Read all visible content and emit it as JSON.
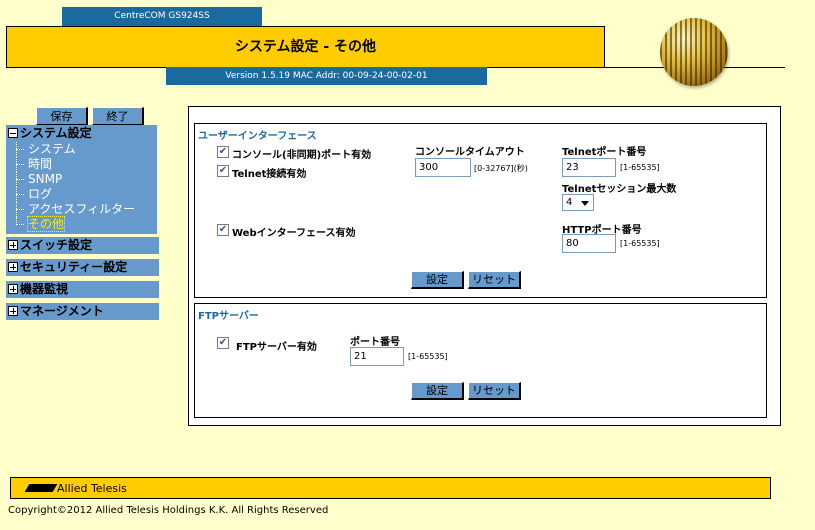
{
  "header": {
    "model": "CentreCOM GS924SS",
    "title": "システム設定 - その他",
    "version": "Version 1.5.19 MAC Addr: 00-09-24-00-02-01"
  },
  "toolbar": {
    "save_label": "保存",
    "exit_label": "終了"
  },
  "sidebar": {
    "system_label": "システム設定",
    "system_items": [
      {
        "label": "システム"
      },
      {
        "label": "時間"
      },
      {
        "label": "SNMP"
      },
      {
        "label": "ログ"
      },
      {
        "label": "アクセスフィルター"
      },
      {
        "label": "その他"
      }
    ],
    "sections": [
      {
        "label": "スイッチ設定"
      },
      {
        "label": "セキュリティー設定"
      },
      {
        "label": "機器監視"
      },
      {
        "label": "マネージメント"
      }
    ]
  },
  "ui_group": {
    "title": "ユーザーインターフェース",
    "console_async_port_label": "コンソール(非同期)ポート有効",
    "console_async_port_enabled": true,
    "telnet_enabled_label": "Telnet接続有効",
    "telnet_enabled": true,
    "web_interface_label": "Webインターフェース有効",
    "web_interface_enabled": true,
    "console_timeout_label": "コンソールタイムアウト",
    "console_timeout_value": "300",
    "console_timeout_range": "[0-32767](秒)",
    "telnet_port_label": "Telnetポート番号",
    "telnet_port_value": "23",
    "telnet_port_range": "[1-65535]",
    "telnet_sessions_label": "Telnetセッション最大数",
    "telnet_sessions_value": "4",
    "http_port_label": "HTTPポート番号",
    "http_port_value": "80",
    "http_port_range": "[1-65535]",
    "set_label": "設定",
    "reset_label": "リセット"
  },
  "ftp_group": {
    "title": "FTPサーバー",
    "ftp_enabled_label": "FTPサーバー有効",
    "ftp_enabled": true,
    "port_label": "ポート番号",
    "port_value": "21",
    "port_range": "[1-65535]",
    "set_label": "設定",
    "reset_label": "リセット"
  },
  "footer": {
    "logo_text": "Allied Telesis",
    "copyright": "Copyright©2012 Allied Telesis Holdings K.K. All Rights Reserved"
  },
  "colors": {
    "background": "#ffffcc",
    "title_bar": "#ffcc00",
    "nav_blue": "#6699cc",
    "header_blue": "#1a6aa0",
    "active_item": "#ffee00"
  },
  "icons": {
    "tree_expanded": "minus-box-icon",
    "tree_collapsed": "plus-box-icon",
    "checkbox_checked": "check-icon",
    "select_arrow": "chevron-down-icon",
    "brand": "allied-telesis-logo-icon",
    "globe": "globe-icon"
  }
}
